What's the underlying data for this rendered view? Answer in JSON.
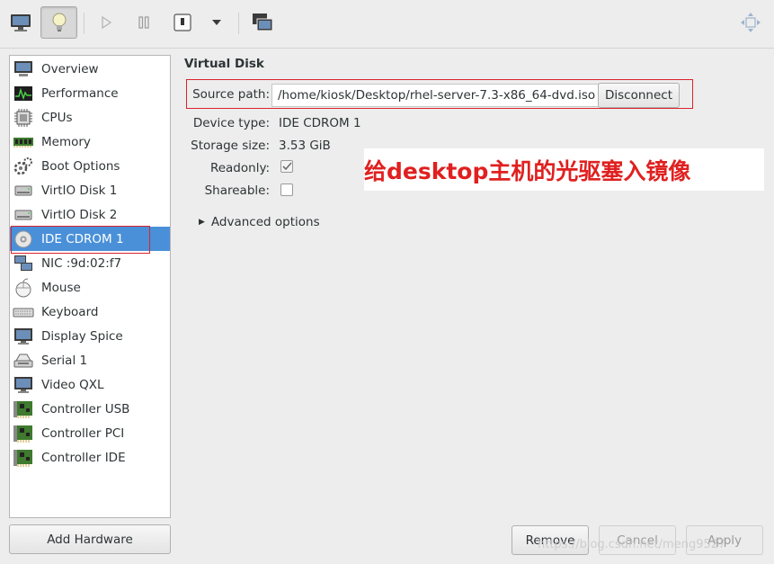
{
  "toolbar": {
    "buttons": [
      {
        "name": "console-view-button",
        "icon": "monitor-icon"
      },
      {
        "name": "details-view-button",
        "icon": "lightbulb-icon",
        "active": true
      },
      {
        "name": "run-button",
        "icon": "play-icon"
      },
      {
        "name": "pause-button",
        "icon": "pause-icon"
      },
      {
        "name": "shutdown-button",
        "icon": "power-icon"
      },
      {
        "name": "shutdown-menu-button",
        "icon": "dropdown-arrow-icon"
      },
      {
        "name": "snapshots-button",
        "icon": "snapshot-icon"
      },
      {
        "name": "fullscreen-button",
        "icon": "move-icon"
      }
    ]
  },
  "sidebar": {
    "items": [
      {
        "label": "Overview",
        "icon": "overview-icon"
      },
      {
        "label": "Performance",
        "icon": "performance-icon"
      },
      {
        "label": "CPUs",
        "icon": "cpu-icon"
      },
      {
        "label": "Memory",
        "icon": "memory-icon"
      },
      {
        "label": "Boot Options",
        "icon": "boot-icon"
      },
      {
        "label": "VirtIO Disk 1",
        "icon": "disk-icon"
      },
      {
        "label": "VirtIO Disk 2",
        "icon": "disk-icon"
      },
      {
        "label": "IDE CDROM 1",
        "icon": "cdrom-icon",
        "selected": true
      },
      {
        "label": "NIC :9d:02:f7",
        "icon": "network-icon"
      },
      {
        "label": "Mouse",
        "icon": "mouse-icon"
      },
      {
        "label": "Keyboard",
        "icon": "keyboard-icon"
      },
      {
        "label": "Display Spice",
        "icon": "display-icon"
      },
      {
        "label": "Serial 1",
        "icon": "serial-icon"
      },
      {
        "label": "Video QXL",
        "icon": "video-icon"
      },
      {
        "label": "Controller USB",
        "icon": "controller-icon"
      },
      {
        "label": "Controller PCI",
        "icon": "controller-icon"
      },
      {
        "label": "Controller IDE",
        "icon": "controller-icon"
      }
    ],
    "add_hardware_label": "Add Hardware"
  },
  "main": {
    "section_title": "Virtual Disk",
    "source_path_label": "Source path:",
    "source_path_value": "/home/kiosk/Desktop/rhel-server-7.3-x86_64-dvd.iso",
    "disconnect_label": "Disconnect",
    "device_type_label": "Device type:",
    "device_type_value": "IDE CDROM 1",
    "storage_size_label": "Storage size:",
    "storage_size_value": "3.53 GiB",
    "readonly_label": "Readonly:",
    "readonly_checked": true,
    "shareable_label": "Shareable:",
    "shareable_checked": false,
    "advanced_label": "Advanced options"
  },
  "annotation": {
    "text": "给desktop主机的光驱塞入镜像",
    "color": "#e02020"
  },
  "actions": {
    "remove_label": "Remove",
    "cancel_label": "Cancel",
    "apply_label": "Apply"
  },
  "watermark": "https://blog.csdn.net/meng9527",
  "colors": {
    "selection": "#4a90d9",
    "highlight_box": "#d9232d"
  }
}
